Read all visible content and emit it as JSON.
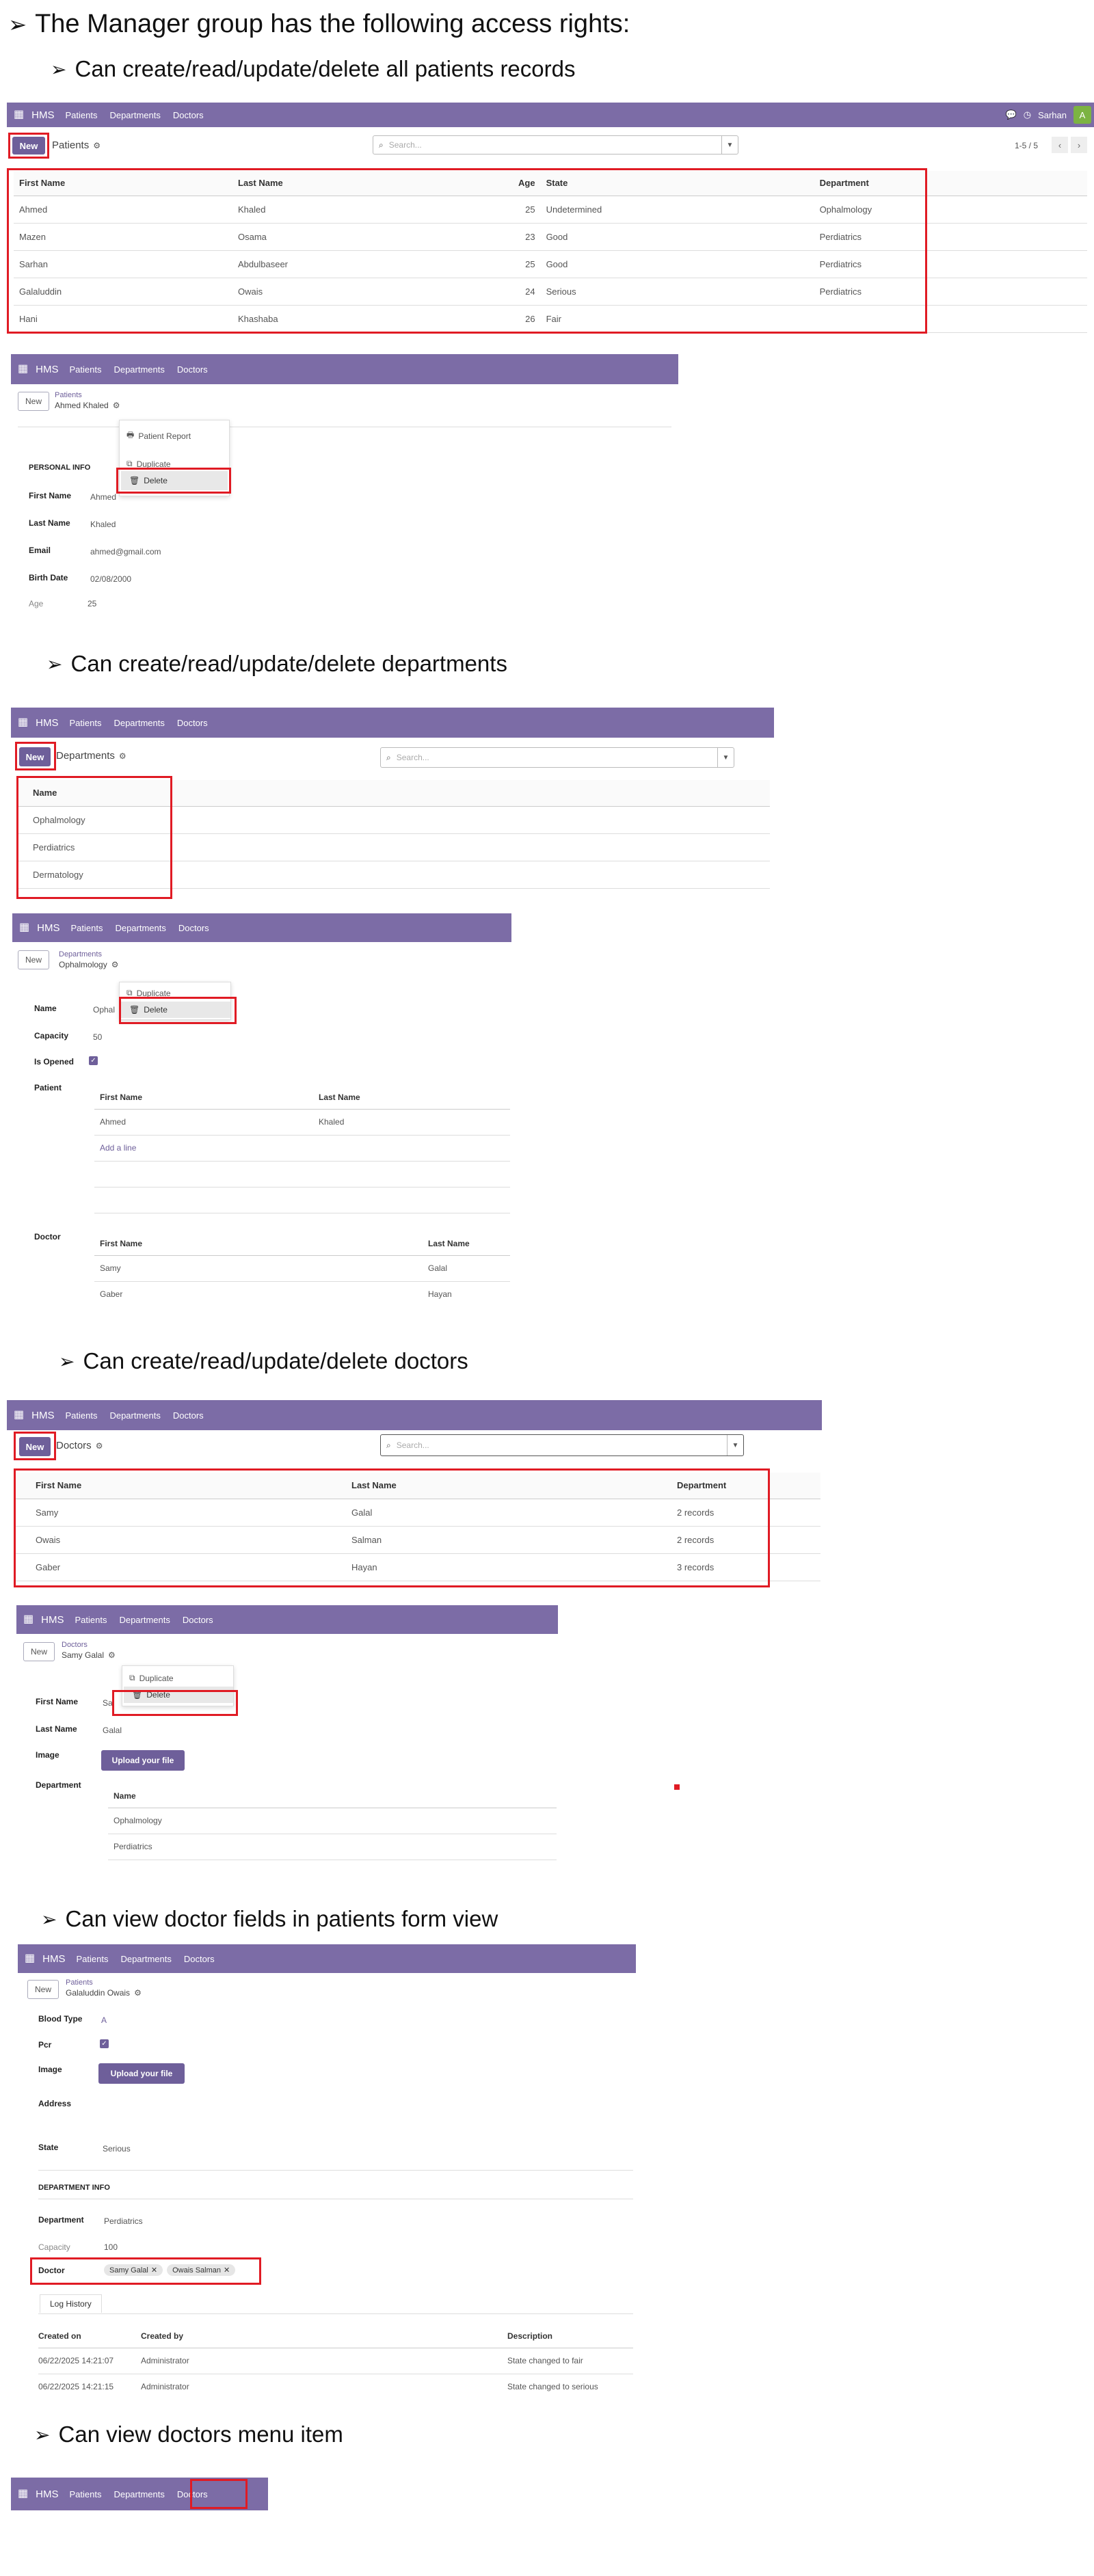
{
  "headings": {
    "main": "The Manager group has the following access rights:",
    "patients": "Can create/read/update/delete all patients records",
    "departments": "Can create/read/update/delete departments",
    "doctors": "Can create/read/update/delete doctors",
    "view_fields": "Can view doctor fields in patients form view",
    "view_menu": "Can view doctors menu item"
  },
  "nav": {
    "app": "HMS",
    "patients": "Patients",
    "departments": "Departments",
    "doctors": "Doctors",
    "user": "Sarhan",
    "avatar": "A"
  },
  "common": {
    "new": "New",
    "search_placeholder": "Search...",
    "duplicate": "Duplicate",
    "delete": "Delete",
    "patient_report": "Patient Report",
    "upload": "Upload your file",
    "add_line": "Add a line"
  },
  "patients_list": {
    "title": "Patients",
    "pager": "1-5 / 5",
    "headers": [
      "First Name",
      "Last Name",
      "Age",
      "State",
      "Department"
    ],
    "rows": [
      [
        "Ahmed",
        "Khaled",
        "25",
        "Undetermined",
        "Ophalmology"
      ],
      [
        "Mazen",
        "Osama",
        "23",
        "Good",
        "Perdiatrics"
      ],
      [
        "Sarhan",
        "Abdulbaseer",
        "25",
        "Good",
        "Perdiatrics"
      ],
      [
        "Galaluddin",
        "Owais",
        "24",
        "Serious",
        "Perdiatrics"
      ],
      [
        "Hani",
        "Khashaba",
        "26",
        "Fair",
        ""
      ]
    ]
  },
  "patient_form": {
    "crumb": "Patients",
    "record": "Ahmed Khaled",
    "section": "PERSONAL INFO",
    "fields": [
      {
        "label": "First Name",
        "value": "Ahmed"
      },
      {
        "label": "Last Name",
        "value": "Khaled"
      },
      {
        "label": "Email",
        "value": "ahmed@gmail.com"
      },
      {
        "label": "Birth Date",
        "value": "02/08/2000"
      },
      {
        "label": "Age",
        "value": "25"
      }
    ]
  },
  "departments_list": {
    "title": "Departments",
    "header": "Name",
    "rows": [
      "Ophalmology",
      "Perdiatrics",
      "Dermatology"
    ]
  },
  "department_form": {
    "crumb": "Departments",
    "record": "Ophalmology",
    "name_label": "Name",
    "name_value": "Ophal",
    "capacity_label": "Capacity",
    "capacity_value": "50",
    "opened_label": "Is Opened",
    "patient_label": "Patient",
    "patient_headers": [
      "First Name",
      "Last Name"
    ],
    "patient_rows": [
      [
        "Ahmed",
        "Khaled"
      ]
    ],
    "doctor_label": "Doctor",
    "doctor_headers": [
      "First Name",
      "Last Name"
    ],
    "doctor_rows": [
      [
        "Samy",
        "Galal"
      ],
      [
        "Gaber",
        "Hayan"
      ]
    ]
  },
  "doctors_list": {
    "title": "Doctors",
    "headers": [
      "First Name",
      "Last Name",
      "Department"
    ],
    "rows": [
      [
        "Samy",
        "Galal",
        "2 records"
      ],
      [
        "Owais",
        "Salman",
        "2 records"
      ],
      [
        "Gaber",
        "Hayan",
        "3 records"
      ]
    ]
  },
  "doctor_form": {
    "crumb": "Doctors",
    "record": "Samy Galal",
    "first_label": "First Name",
    "first_value": "Sa",
    "last_label": "Last Name",
    "last_value": "Galal",
    "image_label": "Image",
    "dept_label": "Department",
    "dept_header": "Name",
    "dept_rows": [
      "Ophalmology",
      "Perdiatrics"
    ]
  },
  "patient_form2": {
    "crumb": "Patients",
    "record": "Galaluddin Owais",
    "blood_label": "Blood Type",
    "blood_value": "A",
    "pcr_label": "Pcr",
    "image_label": "Image",
    "address_label": "Address",
    "state_label": "State",
    "state_value": "Serious",
    "dept_section": "DEPARTMENT INFO",
    "dept_label": "Department",
    "dept_value": "Perdiatrics",
    "capacity_label": "Capacity",
    "capacity_value": "100",
    "doctor_label": "Doctor",
    "doctor_tags": [
      "Samy Galal",
      "Owais Salman"
    ],
    "log_tab": "Log History",
    "log_headers": [
      "Created on",
      "Created by",
      "Description"
    ],
    "log_rows": [
      [
        "06/22/2025 14:21:07",
        "Administrator",
        "State changed to fair"
      ],
      [
        "06/22/2025 14:21:15",
        "Administrator",
        "State changed to serious"
      ]
    ]
  },
  "colors": {
    "accent": "#7c6ca6",
    "highlight": "#e01b24"
  }
}
